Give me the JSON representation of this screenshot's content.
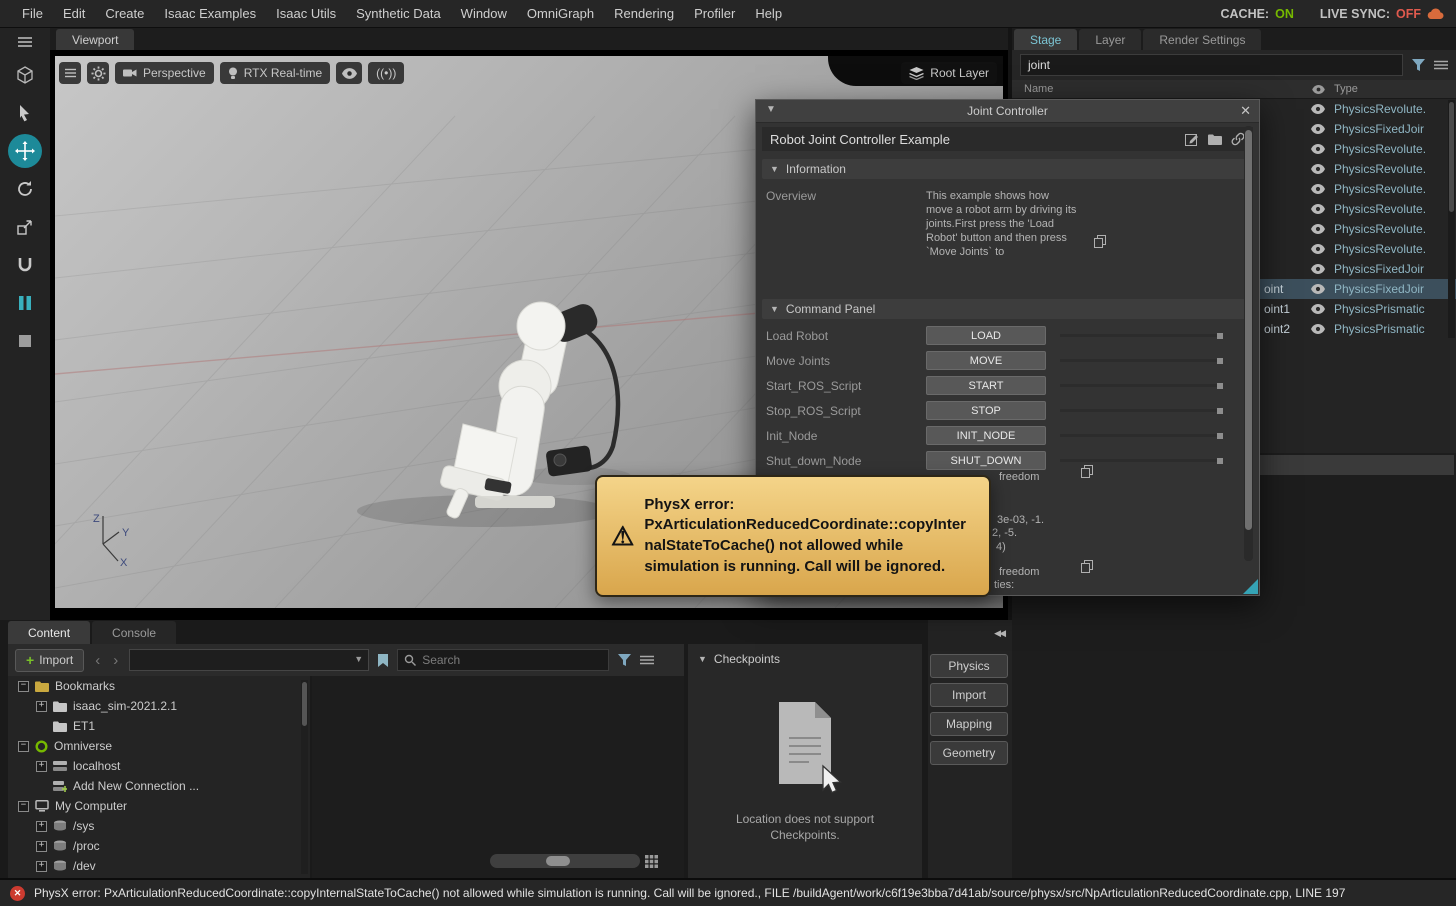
{
  "menubar": {
    "items": [
      "File",
      "Edit",
      "Create",
      "Isaac Examples",
      "Isaac Utils",
      "Synthetic Data",
      "Window",
      "OmniGraph",
      "Rendering",
      "Profiler",
      "Help"
    ],
    "cache": {
      "label": "CACHE:",
      "value": "ON"
    },
    "live_sync": {
      "label": "LIVE SYNC:",
      "value": "OFF"
    }
  },
  "left_toolbar": {
    "icons": [
      {
        "name": "menu-icon",
        "shape": "menu",
        "active": false
      },
      {
        "name": "view-cube-icon",
        "shape": "cube",
        "active": false
      },
      {
        "name": "select-tool-icon",
        "shape": "cursor",
        "active": false
      },
      {
        "name": "move-tool-icon",
        "shape": "move",
        "active": true
      },
      {
        "name": "rotate-tool-icon",
        "shape": "rotate",
        "active": false
      },
      {
        "name": "scale-tool-icon",
        "shape": "scale",
        "active": false
      },
      {
        "name": "snap-tool-icon",
        "shape": "snap",
        "active": false
      },
      {
        "name": "pause-icon",
        "shape": "pause",
        "active": false
      },
      {
        "name": "stop-icon",
        "shape": "stopSquare",
        "active": false
      }
    ]
  },
  "viewport": {
    "tab": "Viewport",
    "toolbar": {
      "perspective": "Perspective",
      "renderer": "RTX Real-time",
      "capture": "((•))",
      "root_layer": "Root Layer"
    },
    "axis": {
      "x": "X",
      "y": "Y",
      "z": "Z"
    }
  },
  "joint_controller": {
    "title": "Joint Controller",
    "example_title": "Robot Joint Controller Example",
    "info_section": "Information",
    "overview_label": "Overview",
    "overview_text": "This example shows how move a robot arm by driving its joints.First press the 'Load Robot' button and then press `Move Joints` to",
    "command_section": "Command Panel",
    "commands": [
      {
        "label": "Load Robot",
        "button": "LOAD"
      },
      {
        "label": "Move Joints",
        "button": "MOVE"
      },
      {
        "label": "Start_ROS_Script",
        "button": "START"
      },
      {
        "label": "Stop_ROS_Script",
        "button": "STOP"
      },
      {
        "label": "Init_Node",
        "button": "INIT_NODE"
      },
      {
        "label": "Shut_down_Node",
        "button": "SHUT_DOWN"
      }
    ],
    "fragments": {
      "dof1": "freedom",
      "v1": "3e-03, -1.",
      "v2": "2, -5.",
      "v3": "4)",
      "dof2": "freedom",
      "props": "ties:"
    }
  },
  "error_tooltip": {
    "text": "PhysX error: PxArticulationReducedCoordinate::copyInternalStateToCache() not allowed while simulation is running. Call will be ignored."
  },
  "stage": {
    "tabs": [
      {
        "label": "Stage",
        "active": true
      },
      {
        "label": "Layer",
        "active": false
      },
      {
        "label": "Render Settings",
        "active": false
      }
    ],
    "search_value": "joint",
    "columns": {
      "name": "Name",
      "type": "Type"
    },
    "rows": [
      {
        "name": "",
        "type": "PhysicsRevolute.",
        "selected": false
      },
      {
        "name": "",
        "type": "PhysicsFixedJoir",
        "selected": false
      },
      {
        "name": "",
        "type": "PhysicsRevolute.",
        "selected": false
      },
      {
        "name": "",
        "type": "PhysicsRevolute.",
        "selected": false
      },
      {
        "name": "",
        "type": "PhysicsRevolute.",
        "selected": false
      },
      {
        "name": "",
        "type": "PhysicsRevolute.",
        "selected": false
      },
      {
        "name": "",
        "type": "PhysicsRevolute.",
        "selected": false
      },
      {
        "name": "",
        "type": "PhysicsRevolute.",
        "selected": false
      },
      {
        "name": "",
        "type": "PhysicsFixedJoir",
        "selected": false
      },
      {
        "name": "oint",
        "type": "PhysicsFixedJoir",
        "selected": true
      },
      {
        "name": "oint1",
        "type": "PhysicsPrismatic",
        "selected": false
      },
      {
        "name": "oint2",
        "type": "PhysicsPrismatic",
        "selected": false
      }
    ]
  },
  "content_browser": {
    "tabs": [
      {
        "label": "Content",
        "active": true
      },
      {
        "label": "Console",
        "active": false
      }
    ],
    "import_button": "Import",
    "search_placeholder": "Search",
    "tree": [
      {
        "label": "Bookmarks",
        "icon": "folder-yellow-icon",
        "shape": "folderYellow",
        "expander": "minus",
        "level": 0
      },
      {
        "label": "isaac_sim-2021.2.1",
        "icon": "folder-icon",
        "shape": "folder",
        "expander": "plus",
        "level": 1
      },
      {
        "label": "ET1",
        "icon": "folder-icon",
        "shape": "folder",
        "expander": "none",
        "level": 1
      },
      {
        "label": "Omniverse",
        "icon": "omniverse-icon",
        "shape": "omniverse",
        "expander": "minus",
        "level": 0
      },
      {
        "label": "localhost",
        "icon": "server-icon",
        "shape": "server",
        "expander": "plus",
        "level": 1
      },
      {
        "label": "Add New Connection ...",
        "icon": "add-connection-icon",
        "shape": "serverAdd",
        "expander": "none",
        "level": 1
      },
      {
        "label": "My Computer",
        "icon": "computer-icon",
        "shape": "computer",
        "expander": "minus",
        "level": 0
      },
      {
        "label": "/sys",
        "icon": "drive-icon",
        "shape": "drive",
        "expander": "plus",
        "level": 1
      },
      {
        "label": "/proc",
        "icon": "drive-icon",
        "shape": "drive",
        "expander": "plus",
        "level": 1
      },
      {
        "label": "/dev",
        "icon": "drive-icon",
        "shape": "drive",
        "expander": "plus",
        "level": 1
      }
    ],
    "checkpoints": {
      "title": "Checkpoints",
      "message_line1": "Location does not support",
      "message_line2": "Checkpoints."
    }
  },
  "side_panel": {
    "buttons": [
      "Physics",
      "Import",
      "Mapping",
      "Geometry"
    ]
  },
  "status_bar": {
    "text": "PhysX error: PxArticulationReducedCoordinate::copyInternalStateToCache() not allowed while simulation is running. Call will be ignored., FILE /buildAgent/work/c6f19e3bba7d41ab/source/physx/src/NpArticulationReducedCoordinate.cpp, LINE 197"
  },
  "colors": {
    "accent_green": "#76b900",
    "accent_red": "#e05a4e",
    "accent_teal": "#2e9ca6",
    "type_text": "#8fb6c4",
    "selected_row": "#3c4f5c",
    "tooltip_bg": "#e8bf6a"
  }
}
